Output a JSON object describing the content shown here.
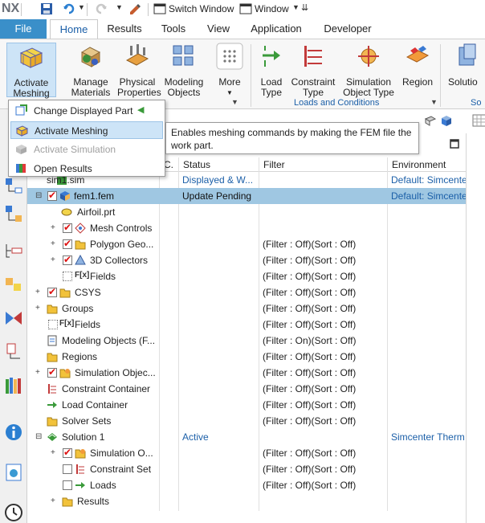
{
  "quick_access": {
    "logo": "NX",
    "switch_window": "Switch Window",
    "window": "Window"
  },
  "tabs": [
    "File",
    "Home",
    "Results",
    "Tools",
    "View",
    "Application",
    "Developer"
  ],
  "ribbon": {
    "activate_meshing": [
      "Activate",
      "Meshing"
    ],
    "manage_materials": [
      "Manage",
      "Materials"
    ],
    "physical_properties": [
      "Physical",
      "Properties"
    ],
    "modeling_objects": [
      "Modeling",
      "Objects"
    ],
    "more": "More",
    "load_type": [
      "Load",
      "Type"
    ],
    "constraint_type": [
      "Constraint",
      "Type"
    ],
    "simulation_object_type": [
      "Simulation",
      "Object Type"
    ],
    "region": "Region",
    "solution": "Solutio",
    "group_loads": "Loads and Conditions",
    "group_so": "So"
  },
  "menu": {
    "items": [
      {
        "label": "Change Displayed Part",
        "icon": "change-part-icon"
      },
      {
        "label": "Activate Meshing",
        "icon": "mesh-icon"
      },
      {
        "label": "Activate Simulation",
        "icon": "simulation-icon"
      },
      {
        "label": "Open Results",
        "icon": "results-icon"
      }
    ],
    "tooltip": "Enables meshing commands by making the FEM file the work part."
  },
  "columns": {
    "c": "C.",
    "status": "Status",
    "filter": "Filter",
    "environment": "Environment"
  },
  "tree": [
    {
      "name": "sim1.sim",
      "status": "Displayed & W...",
      "filter": "",
      "env": "Default: Simcente"
    },
    {
      "name": "fem1.fem",
      "status": "Update Pending",
      "filter": "",
      "env": "Default: Simcente"
    },
    {
      "name": "Airfoil.prt",
      "status": "",
      "filter": "",
      "env": ""
    },
    {
      "name": "Mesh Controls",
      "status": "",
      "filter": "",
      "env": ""
    },
    {
      "name": "Polygon Geo...",
      "status": "",
      "filter": "(Filter : Off)(Sort : Off)",
      "env": ""
    },
    {
      "name": "3D Collectors",
      "status": "",
      "filter": "(Filter : Off)(Sort : Off)",
      "env": ""
    },
    {
      "name": "Fields",
      "status": "",
      "filter": "(Filter : Off)(Sort : Off)",
      "env": ""
    },
    {
      "name": "CSYS",
      "status": "",
      "filter": "(Filter : Off)(Sort : Off)",
      "env": ""
    },
    {
      "name": "Groups",
      "status": "",
      "filter": "(Filter : Off)(Sort : Off)",
      "env": ""
    },
    {
      "name": "Fields",
      "status": "",
      "filter": "(Filter : Off)(Sort : Off)",
      "env": ""
    },
    {
      "name": "Modeling Objects (F...",
      "status": "",
      "filter": "(Filter : On)(Sort : Off)",
      "env": ""
    },
    {
      "name": "Regions",
      "status": "",
      "filter": "(Filter : Off)(Sort : Off)",
      "env": ""
    },
    {
      "name": "Simulation Objec...",
      "status": "",
      "filter": "(Filter : Off)(Sort : Off)",
      "env": ""
    },
    {
      "name": "Constraint Container",
      "status": "",
      "filter": "(Filter : Off)(Sort : Off)",
      "env": ""
    },
    {
      "name": "Load Container",
      "status": "",
      "filter": "(Filter : Off)(Sort : Off)",
      "env": ""
    },
    {
      "name": "Solver Sets",
      "status": "",
      "filter": "(Filter : Off)(Sort : Off)",
      "env": ""
    },
    {
      "name": "Solution 1",
      "status": "Active",
      "filter": "",
      "env": "Simcenter Therm"
    },
    {
      "name": "Simulation O...",
      "status": "",
      "filter": "(Filter : Off)(Sort : Off)",
      "env": ""
    },
    {
      "name": "Constraint Set",
      "status": "",
      "filter": "(Filter : Off)(Sort : Off)",
      "env": ""
    },
    {
      "name": "Loads",
      "status": "",
      "filter": "(Filter : Off)(Sort : Off)",
      "env": ""
    },
    {
      "name": "Results",
      "status": "",
      "filter": "",
      "env": ""
    }
  ],
  "colors": {
    "accent": "#3a8fc9",
    "highlight_row": "#9fc7e2",
    "link_blue": "#1b5fa8"
  }
}
